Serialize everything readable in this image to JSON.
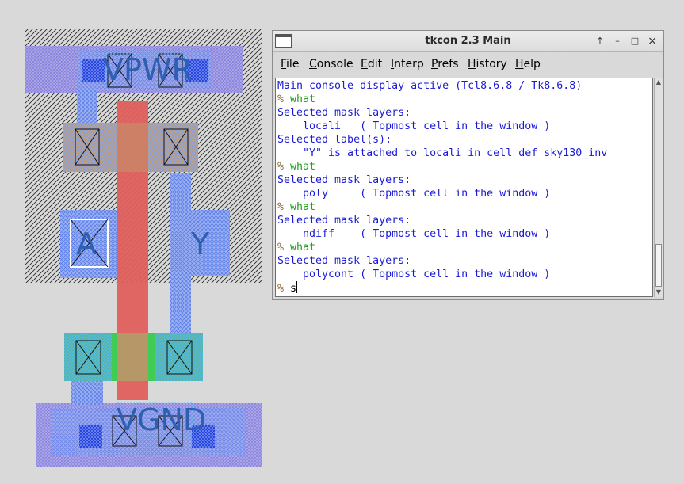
{
  "layout": {
    "labels": {
      "power": "VPWR",
      "ground": "VGND",
      "input": "A",
      "output": "Y"
    }
  },
  "window": {
    "title": "tkcon 2.3 Main",
    "buttons": [
      "↑",
      "–",
      "□",
      "×"
    ],
    "menu": [
      {
        "label": "File",
        "u": "F"
      },
      {
        "label": "Console",
        "u": "C"
      },
      {
        "label": "Edit",
        "u": "E"
      },
      {
        "label": "Interp",
        "u": "I"
      },
      {
        "label": "Prefs",
        "u": "P"
      },
      {
        "label": "History",
        "u": "H"
      },
      {
        "label": "Help",
        "u": "H"
      }
    ]
  },
  "console": {
    "lines": [
      {
        "type": "out",
        "text": "Main console display active (Tcl8.6.8 / Tk8.6.8)"
      },
      {
        "type": "cmd",
        "prompt": "% ",
        "text": "what"
      },
      {
        "type": "out",
        "text": "Selected mask layers:"
      },
      {
        "type": "out",
        "text": "    locali   ( Topmost cell in the window )"
      },
      {
        "type": "out",
        "text": "Selected label(s):"
      },
      {
        "type": "out",
        "text": "    \"Y\" is attached to locali in cell def sky130_inv"
      },
      {
        "type": "cmd",
        "prompt": "% ",
        "text": "what"
      },
      {
        "type": "out",
        "text": "Selected mask layers:"
      },
      {
        "type": "out",
        "text": "    poly     ( Topmost cell in the window )"
      },
      {
        "type": "cmd",
        "prompt": "% ",
        "text": "what"
      },
      {
        "type": "out",
        "text": "Selected mask layers:"
      },
      {
        "type": "out",
        "text": "    ndiff    ( Topmost cell in the window )"
      },
      {
        "type": "cmd",
        "prompt": "% ",
        "text": "what"
      },
      {
        "type": "out",
        "text": "Selected mask layers:"
      },
      {
        "type": "out",
        "text": "    polycont ( Topmost cell in the window )"
      },
      {
        "type": "input",
        "prompt": "% ",
        "text": "s"
      }
    ],
    "colors": {
      "output": "#1a1ad6",
      "command": "#1f9f1f",
      "prompt": "#8a6d3b"
    }
  }
}
